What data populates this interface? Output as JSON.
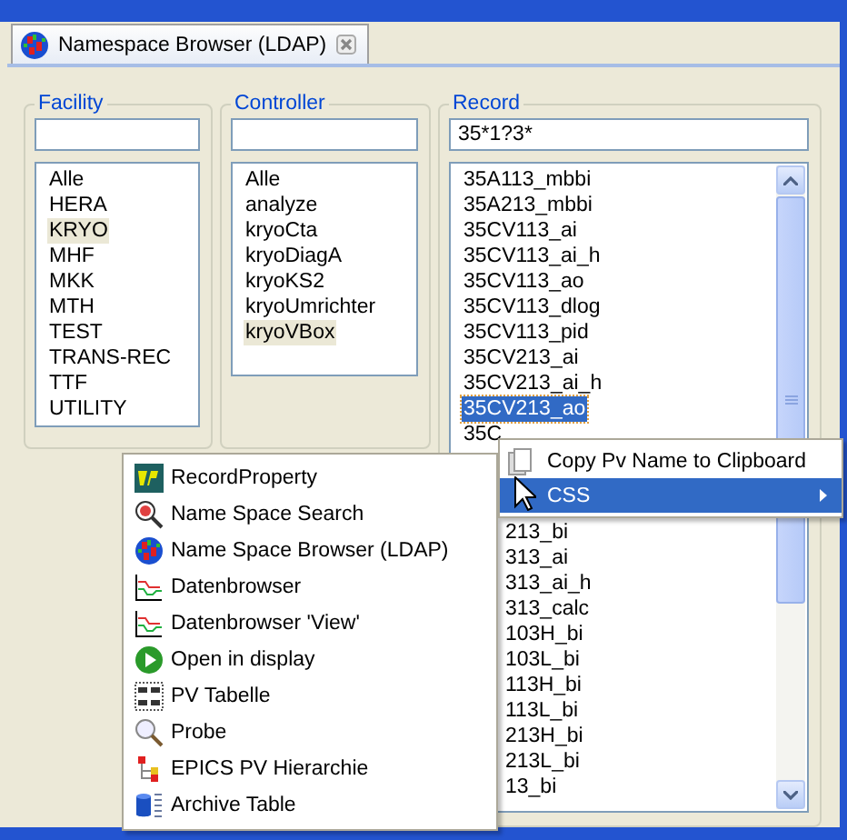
{
  "tab": {
    "title": "Namespace Browser (LDAP)",
    "selected": true
  },
  "columns": [
    {
      "title": "Facility",
      "items": [
        {
          "label": "Alle",
          "selected": false
        },
        {
          "label": "HERA",
          "selected": false
        },
        {
          "label": "KRYO",
          "selected": true
        },
        {
          "label": "MHF",
          "selected": false
        },
        {
          "label": "MKK",
          "selected": false
        },
        {
          "label": "MTH",
          "selected": false
        },
        {
          "label": "TEST",
          "selected": false
        },
        {
          "label": "TRANS-REC",
          "selected": false
        },
        {
          "label": "TTF",
          "selected": false
        },
        {
          "label": "UTILITY",
          "selected": false
        }
      ]
    },
    {
      "title": "Controller",
      "items": [
        {
          "label": "Alle",
          "selected": false
        },
        {
          "label": "analyze",
          "selected": false
        },
        {
          "label": "kryoCta",
          "selected": false
        },
        {
          "label": "kryoDiagA",
          "selected": false
        },
        {
          "label": "kryoKS2",
          "selected": false
        },
        {
          "label": "kryoUmrichter",
          "selected": false
        },
        {
          "label": "kryoVBox",
          "selected": true
        }
      ]
    },
    {
      "title": "Record",
      "filter": "35*1?3*",
      "items": [
        {
          "label": "35A113_mbbi",
          "selected": false,
          "kind": "full"
        },
        {
          "label": "35A213_mbbi",
          "selected": false,
          "kind": "full"
        },
        {
          "label": "35CV113_ai",
          "selected": false,
          "kind": "full"
        },
        {
          "label": "35CV113_ai_h",
          "selected": false,
          "kind": "full"
        },
        {
          "label": "35CV113_ao",
          "selected": false,
          "kind": "full"
        },
        {
          "label": "35CV113_dlog",
          "selected": false,
          "kind": "full"
        },
        {
          "label": "35CV113_pid",
          "selected": false,
          "kind": "full"
        },
        {
          "label": "35CV213_ai",
          "selected": false,
          "kind": "full"
        },
        {
          "label": "35CV213_ai_h",
          "selected": false,
          "kind": "full"
        },
        {
          "label": "35CV213_ao",
          "selected": true,
          "kind": "full"
        },
        {
          "label": "35C",
          "selected": false,
          "kind": "full"
        },
        {
          "label": "213_bi",
          "selected": false,
          "kind": "covered"
        },
        {
          "label": "313_ai",
          "selected": false,
          "kind": "covered"
        },
        {
          "label": "313_ai_h",
          "selected": false,
          "kind": "covered"
        },
        {
          "label": "313_calc",
          "selected": false,
          "kind": "covered"
        },
        {
          "label": "103H_bi",
          "selected": false,
          "kind": "covered"
        },
        {
          "label": "103L_bi",
          "selected": false,
          "kind": "covered"
        },
        {
          "label": "113H_bi",
          "selected": false,
          "kind": "covered"
        },
        {
          "label": "113L_bi",
          "selected": false,
          "kind": "covered"
        },
        {
          "label": "213H_bi",
          "selected": false,
          "kind": "covered"
        },
        {
          "label": "213L_bi",
          "selected": false,
          "kind": "covered"
        },
        {
          "label": "13_bi",
          "selected": false,
          "kind": "covered"
        }
      ]
    }
  ],
  "context_menu": [
    {
      "label": "RecordProperty",
      "kind": "rp"
    },
    {
      "label": "Name Space Search",
      "kind": "search-globe"
    },
    {
      "label": "Name Space Browser (LDAP)",
      "kind": "globe"
    },
    {
      "label": "Datenbrowser",
      "kind": "trend"
    },
    {
      "label": "Datenbrowser 'View'",
      "kind": "trend"
    },
    {
      "label": "Open in display",
      "kind": "play"
    },
    {
      "label": "PV Tabelle",
      "kind": "table"
    },
    {
      "label": "Probe",
      "kind": "magnifier"
    },
    {
      "label": "EPICS PV Hierarchie",
      "kind": "tree"
    },
    {
      "label": "Archive Table",
      "kind": "cylinder"
    }
  ],
  "submenu": [
    {
      "label": "Copy Pv Name to Clipboard",
      "selected": false
    },
    {
      "label": "CSS",
      "selected": true,
      "has_submenu": true
    }
  ]
}
